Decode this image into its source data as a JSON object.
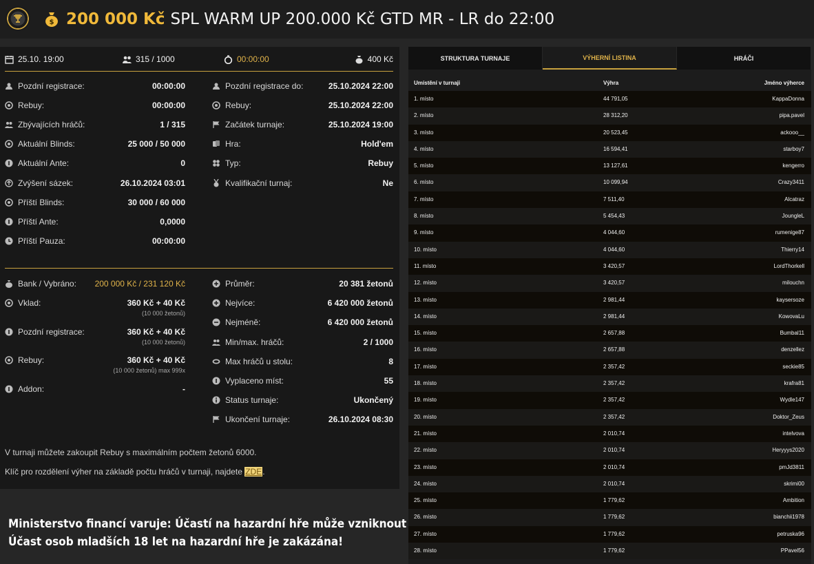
{
  "header": {
    "amount": "200 000 Kč",
    "title": "SPL WARM UP 200.000 Kč GTD MR - LR do 22:00",
    "icons": [
      "trophy-logo-icon",
      "money-bag-icon"
    ]
  },
  "topstrip": {
    "date": "25.10. 19:00",
    "players": "315 / 1000",
    "timer": "00:00:00",
    "buyin": "400 Kč"
  },
  "info_left": [
    {
      "label": "Pozdní registrace:",
      "value": "00:00:00",
      "icon": "user-icon"
    },
    {
      "label": "Rebuy:",
      "value": "00:00:00",
      "icon": "chips-icon"
    },
    {
      "label": "Zbývajících hráčů:",
      "value": "1 / 315",
      "icon": "users-icon"
    },
    {
      "label": "Aktuální Blinds:",
      "value": "25 000 / 50 000",
      "icon": "chips-icon"
    },
    {
      "label": "Aktuální Ante:",
      "value": "0",
      "icon": "coin-icon"
    },
    {
      "label": "Zvýšení sázek:",
      "value": "26.10.2024 03:01",
      "icon": "arrow-up-icon"
    },
    {
      "label": "Příští Blinds:",
      "value": "30 000 / 60 000",
      "icon": "chips-icon"
    },
    {
      "label": "Příští Ante:",
      "value": "0,0000",
      "icon": "coin-icon"
    },
    {
      "label": "Příští Pauza:",
      "value": "00:00:00",
      "icon": "clock-icon"
    }
  ],
  "info_right": [
    {
      "label": "Pozdní registrace do:",
      "value": "25.10.2024 22:00",
      "icon": "user-icon"
    },
    {
      "label": "Rebuy:",
      "value": "25.10.2024 22:00",
      "icon": "chips-icon"
    },
    {
      "label": "Začátek turnaje:",
      "value": "25.10.2024 19:00",
      "icon": "flag-icon"
    },
    {
      "label": "Hra:",
      "value": "Hold'em",
      "icon": "cards-icon"
    },
    {
      "label": "Typ:",
      "value": "Rebuy",
      "icon": "clubs-icon"
    },
    {
      "label": "Kvalifikační turnaj:",
      "value": "Ne",
      "icon": "medal-icon"
    }
  ],
  "bank_left": [
    {
      "label": "Bank / Vybráno:",
      "value": "200 000 Kč / 231 120 Kč",
      "sub": "",
      "icon": "money-bag-icon"
    },
    {
      "label": "Vklad:",
      "value": "360 Kč + 40 Kč",
      "sub": "(10 000 žetonů)",
      "icon": "chips-icon"
    },
    {
      "label": "Pozdní registrace:",
      "value": "360 Kč + 40 Kč",
      "sub": "(10 000 žetonů)",
      "icon": "coin-icon"
    },
    {
      "label": "Rebuy:",
      "value": "360 Kč + 40 Kč",
      "sub": "(10 000 žetonů) max 999x",
      "icon": "chips-icon"
    },
    {
      "label": "Addon:",
      "value": "-",
      "sub": "",
      "icon": "coin-icon"
    }
  ],
  "bank_right": [
    {
      "label": "Průměr:",
      "value": "20 381 žetonů",
      "icon": "plus-circle-icon"
    },
    {
      "label": "Nejvíce:",
      "value": "6 420 000 žetonů",
      "icon": "plus-circle-icon"
    },
    {
      "label": "Nejméně:",
      "value": "6 420 000 žetonů",
      "icon": "minus-circle-icon"
    },
    {
      "label": "Min/max. hráčů:",
      "value": "2 / 1000",
      "icon": "users-icon"
    },
    {
      "label": "Max hráčů u stolu:",
      "value": "8",
      "icon": "table-icon"
    },
    {
      "label": "Vyplaceno míst:",
      "value": "55",
      "icon": "coin-icon"
    },
    {
      "label": "Status turnaje:",
      "value": "Ukončený",
      "icon": "info-icon"
    },
    {
      "label": "Ukončení turnaje:",
      "value": "26.10.2024 08:30",
      "icon": "flag-icon"
    }
  ],
  "notes": {
    "rebuy_note": "V turnaji můžete zakoupit Rebuy s maximálním počtem žetonů 6000.",
    "key_note": "Klíč pro rozdělení výher na základě počtu hráčů v turnaji, najdete",
    "key_link": "ZDE",
    "key_end": "."
  },
  "warning": {
    "line1": "Ministerstvo financí varuje: Účastí na hazardní hře může vzniknout závislost!",
    "line2": "Účast osob mladších 18 let na hazardní hře je zakázána!"
  },
  "tabs": [
    "STRUKTURA TURNAJE",
    "VÝHERNÍ LISTINA",
    "HRÁČI"
  ],
  "active_tab": 1,
  "table": {
    "headers": [
      "Umístění v turnaji",
      "Výhra",
      "Jméno výherce"
    ],
    "rows": [
      [
        "1. místo",
        "44 791,05",
        "KappaDonna"
      ],
      [
        "2. místo",
        "28 312,20",
        "pipa.pavel"
      ],
      [
        "3. místo",
        "20 523,45",
        "ackooo__"
      ],
      [
        "4. místo",
        "16 594,41",
        "starboy7"
      ],
      [
        "5. místo",
        "13 127,61",
        "kengerro"
      ],
      [
        "6. místo",
        "10 099,94",
        "Crazy3411"
      ],
      [
        "7. místo",
        "7 511,40",
        "Alcatraz"
      ],
      [
        "8. místo",
        "5 454,43",
        "JoungleL"
      ],
      [
        "9. místo",
        "4 044,60",
        "rumenige87"
      ],
      [
        "10. místo",
        "4 044,60",
        "Thierry14"
      ],
      [
        "11. místo",
        "3 420,57",
        "LordThorkell"
      ],
      [
        "12. místo",
        "3 420,57",
        "milouchn"
      ],
      [
        "13. místo",
        "2 981,44",
        "kaysersoze"
      ],
      [
        "14. místo",
        "2 981,44",
        "KowovaLu"
      ],
      [
        "15. místo",
        "2 657,88",
        "Bumbal11"
      ],
      [
        "16. místo",
        "2 657,88",
        "denzellez"
      ],
      [
        "17. místo",
        "2 357,42",
        "seckie85"
      ],
      [
        "18. místo",
        "2 357,42",
        "krafra81"
      ],
      [
        "19. místo",
        "2 357,42",
        "Wydle147"
      ],
      [
        "20. místo",
        "2 357,42",
        "Doktor_Zeus"
      ],
      [
        "21. místo",
        "2 010,74",
        "intelvova"
      ],
      [
        "22. místo",
        "2 010,74",
        "Heryyys2020"
      ],
      [
        "23. místo",
        "2 010,74",
        "pmJd3811"
      ],
      [
        "24. místo",
        "2 010,74",
        "skrimi00"
      ],
      [
        "25. místo",
        "1 779,62",
        "Ambition"
      ],
      [
        "26. místo",
        "1 779,62",
        "bianchii1978"
      ],
      [
        "27. místo",
        "1 779,62",
        "petruska96"
      ],
      [
        "28. místo",
        "1 779,62",
        "PPavel56"
      ]
    ]
  },
  "colors": {
    "gold": "#e0b34a",
    "background": "#262626",
    "panel": "#181818"
  }
}
